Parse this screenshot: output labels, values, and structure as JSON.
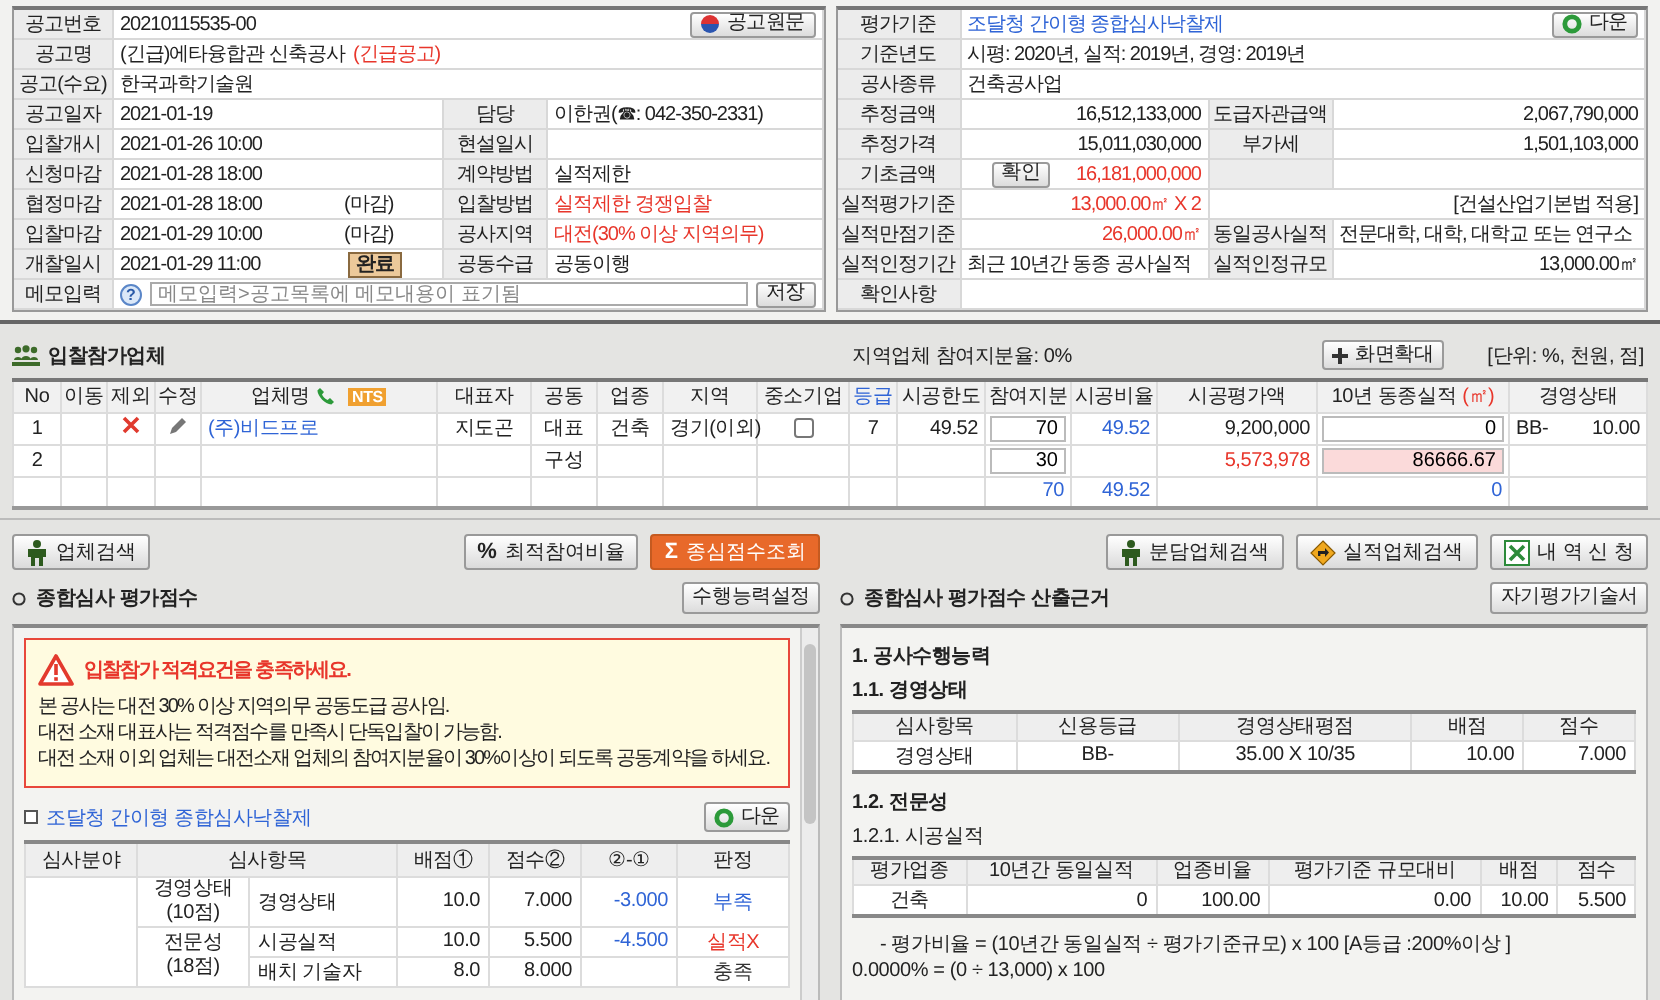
{
  "notice": [
    {
      "kind": "single",
      "label": "공고번호",
      "value": "20210115535-00",
      "button": "공고원문"
    },
    {
      "kind": "single",
      "label": "공고명",
      "value": "(긴급)에타융합관 신축공사",
      "note": "(긴급공고)"
    },
    {
      "kind": "single",
      "label": "공고(수요)",
      "value": "한국과학기술원"
    },
    {
      "kind": "pair",
      "label": "공고일자",
      "value": "2021-01-19",
      "label2": "담당",
      "value2": "이한권(☎: 042-350-2331)"
    },
    {
      "kind": "pair",
      "label": "입찰개시",
      "value": "2021-01-26 10:00",
      "label2": "현설일시"
    },
    {
      "kind": "pair",
      "label": "신청마감",
      "value": "2021-01-28 18:00",
      "label2": "계약방법",
      "value2": "실적제한"
    },
    {
      "kind": "pair",
      "label": "협정마감",
      "value": "2021-01-28 18:00",
      "status": "(마감)",
      "label2": "입찰방법",
      "value2": "실적제한 경쟁입찰",
      "alert": true
    },
    {
      "kind": "pair",
      "label": "입찰마감",
      "value": "2021-01-29 10:00",
      "status": "(마감)",
      "label2": "공사지역",
      "value2": "대전(30% 이상 지역의무)",
      "alert": true
    },
    {
      "kind": "pair",
      "label": "개찰일시",
      "value": "2021-01-29 11:00",
      "badge": "완료",
      "label2": "공동수급",
      "value2": "공동이행"
    },
    {
      "kind": "memo",
      "label": "메모입력",
      "help": "?",
      "placeholder": "메모입력>공고목록에 메모내용이 표기됨",
      "button": "저장"
    }
  ],
  "criteria": [
    {
      "kind": "link",
      "label": "평가기준",
      "value": "조달청 간이형 종합심사낙찰제",
      "button": "다운"
    },
    {
      "kind": "single",
      "label": "기준년도",
      "value": "시평: 2020년, 실적: 2019년, 경영: 2019년"
    },
    {
      "kind": "single",
      "label": "공사종류",
      "value": "건축공사업"
    },
    {
      "kind": "amount",
      "label": "추정금액",
      "value": "16,512,133,000",
      "label2": "도급자관급액",
      "value2": "2,067,790,000"
    },
    {
      "kind": "amount",
      "label": "추정가격",
      "value": "15,011,030,000",
      "label2": "부가세",
      "value2": "1,501,103,000"
    },
    {
      "kind": "amount",
      "label": "기초금액",
      "button": "확인",
      "value": "16,181,000,000",
      "alert": true
    },
    {
      "kind": "wide",
      "label": "실적평가기준",
      "value": "13,000.00㎡  X 2",
      "note": "[건설산업기본법 적용]",
      "alert": true
    },
    {
      "kind": "amount_text",
      "label": "실적만점기준",
      "value": "26,000.00㎡",
      "label2": "동일공사실적",
      "value2": "전문대학, 대학, 대학교 또는 연구소",
      "alert": true
    },
    {
      "kind": "text_amount",
      "label": "실적인정기간",
      "value": "최근 10년간 동종 공사실적",
      "label2": "실적인정규모",
      "value2": "13,000.00㎡"
    },
    {
      "kind": "single",
      "label": "확인사항"
    }
  ],
  "bidders": {
    "title": "입찰참가업체",
    "region_share": "지역업체 참여지분율: 0%",
    "zoom_button": "화면확대",
    "unit": "[단위: %, 천원, 점]",
    "columns": [
      {
        "label": "No"
      },
      {
        "label": "이동"
      },
      {
        "label": "제외"
      },
      {
        "label": "수정"
      },
      {
        "label": "업체명",
        "badge": "NTS"
      },
      {
        "label": "대표자"
      },
      {
        "label": "공동"
      },
      {
        "label": "업종"
      },
      {
        "label": "지역"
      },
      {
        "label": "중소기업"
      },
      {
        "label": "등급",
        "highlight": true
      },
      {
        "label": "시공한도"
      },
      {
        "label": "참여지분"
      },
      {
        "label": "시공비율"
      },
      {
        "label": "시공평가액"
      },
      {
        "label": "10년 동종실적",
        "unit": "(㎡)"
      },
      {
        "label": "경영상태"
      }
    ],
    "rows": [
      {
        "no": "1",
        "delete": true,
        "edit": true,
        "name": "(주)비드프로",
        "ceo": "지도곤",
        "joint": "대표",
        "industry": "건축",
        "region": "경기(이외)",
        "sme": false,
        "grade": "7",
        "limit": "49.52",
        "share": "70",
        "ratio": "49.52",
        "amount": "9,200,000",
        "record": "0",
        "credit": "BB-",
        "credit_score": "10.00"
      },
      {
        "no": "2",
        "joint": "구성",
        "share": "30",
        "amount": "5,573,978",
        "amount_alert": true,
        "record": "86666.67",
        "record_alert": true
      }
    ],
    "total": {
      "share": "70",
      "ratio": "49.52",
      "record": "0"
    }
  },
  "actions_left": [
    {
      "kind": "person",
      "label": "업체검색",
      "primary": false
    },
    {
      "kind": "percent",
      "symbol": "%",
      "label": "최적참여비율",
      "primary": false
    },
    {
      "kind": "sigma",
      "symbol": "Σ",
      "label": "종심점수조회",
      "primary": true
    }
  ],
  "actions_right": [
    {
      "kind": "person",
      "label": "분담업체검색",
      "primary": false
    },
    {
      "kind": "sign",
      "label": "실적업체검색",
      "primary": false
    },
    {
      "kind": "sheet",
      "label": "내 역 신 청",
      "primary": false
    }
  ],
  "evaluation": {
    "title": "종합심사 평가점수",
    "button": "수행능력설정",
    "warning": {
      "title": "입찰참가 적격요건을 충족하세요.",
      "lines": [
        "본 공사는 대전 30% 이상 지역의무 공동도급 공사임.",
        "대전 소재 대표사는 적격점수를 만족시 단독입찰이 가능함.",
        "대전 소재 이외 업체는 대전소재 업체의 참여지분율이 30%이상이 되도록 공동계약을 하세요."
      ]
    },
    "method": "조달청 간이형 종합심사낙찰제",
    "download": "다운",
    "columns": [
      "심사분야",
      "심사항목",
      "배점①",
      "점수②",
      "②-①",
      "판정"
    ],
    "groups": [
      {
        "category": "경영상태",
        "points": "(10점)",
        "items": [
          {
            "name": "경영상태",
            "weight": "10.0",
            "score": "7.000",
            "diff": "-3.000",
            "verdict": "부족",
            "color": "#2f64d6"
          }
        ]
      },
      {
        "category": "전문성",
        "points": "(18점)",
        "items": [
          {
            "name": "시공실적",
            "weight": "10.0",
            "score": "5.500",
            "diff": "-4.500",
            "verdict": "실적X",
            "color": "#e8362b"
          },
          {
            "name": "배치 기술자",
            "weight": "8.0",
            "score": "8.000",
            "verdict": "충족",
            "color": "#333333"
          }
        ]
      }
    ]
  },
  "basis": {
    "title": "종합심사 평가점수 산출근거",
    "button": "자기평가기술서",
    "sections": [
      {
        "kind": "heading",
        "text": "1. 공사수행능력"
      },
      {
        "kind": "heading",
        "text": "1.1. 경영상태"
      },
      {
        "kind": "table",
        "columns": [
          {
            "label": "심사항목",
            "kind": "text"
          },
          {
            "label": "신용등급",
            "kind": "text"
          },
          {
            "label": "경영상태평점",
            "kind": "text"
          },
          {
            "label": "배점",
            "kind": "number"
          },
          {
            "label": "점수",
            "kind": "number"
          }
        ],
        "rows": [
          [
            "경영상태",
            "BB-",
            "35.00 X 10/35",
            "10.00",
            "7.000"
          ]
        ]
      },
      {
        "kind": "heading",
        "text": "1.2. 전문성"
      },
      {
        "kind": "minor",
        "text": "1.2.1. 시공실적"
      },
      {
        "kind": "table",
        "columns": [
          {
            "label": "평가업종",
            "kind": "text"
          },
          {
            "label": "10년간 동일실적",
            "kind": "number"
          },
          {
            "label": "업종비율",
            "kind": "number"
          },
          {
            "label": "평가기준 규모대비",
            "kind": "number"
          },
          {
            "label": "배점",
            "kind": "number"
          },
          {
            "label": "점수",
            "kind": "number"
          }
        ],
        "rows": [
          [
            "건축",
            "0",
            "100.00",
            "0.00",
            "10.00",
            "5.500"
          ]
        ]
      },
      {
        "kind": "formula",
        "lines": [
          "- 평가비율 = (10년간 동일실적 ÷ 평가기준규모) x 100   [A등급 :200%이상 ]",
          "0.0000% = (0 ÷ 13,000) x 100"
        ]
      }
    ]
  }
}
